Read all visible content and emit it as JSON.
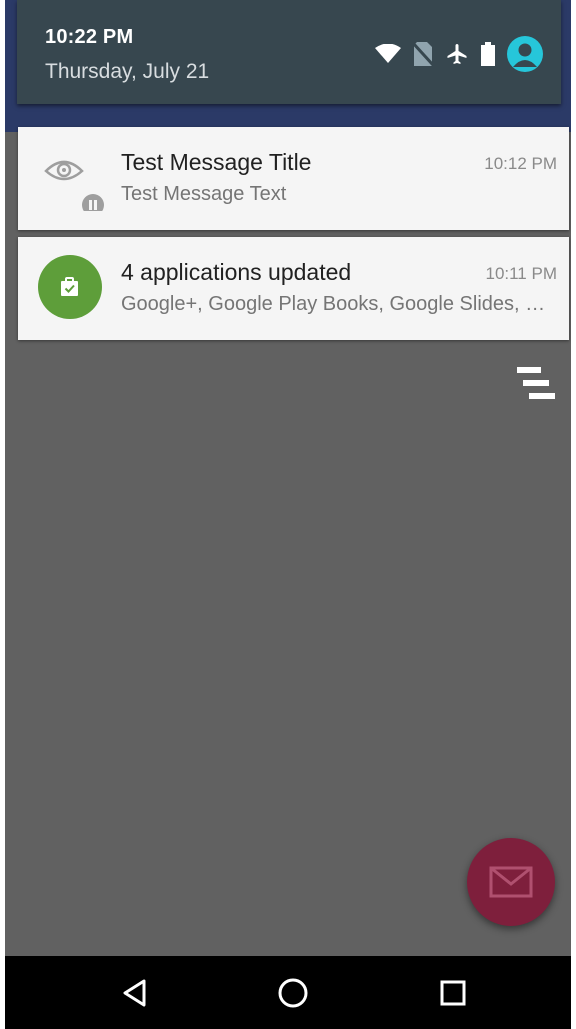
{
  "status_bar": {
    "time": "10:22 PM",
    "date": "Thursday, July 21",
    "icons": [
      "wifi-icon",
      "no-sim-icon",
      "airplane-mode-icon",
      "battery-icon",
      "user-avatar-icon"
    ],
    "avatar_color": "#26c6da"
  },
  "notifications": [
    {
      "icon": "eye-app-icon",
      "title": "Test Message Title",
      "text": "Test Message Text",
      "time": "10:12 PM"
    },
    {
      "icon": "app-update-icon",
      "icon_bg": "#5e9e3a",
      "title": "4 applications updated",
      "text": "Google+, Google Play Books, Google Slides, Google Docs",
      "time": "10:11 PM"
    }
  ],
  "actions": {
    "clear_all_icon": "clear-all-icon",
    "fab_icon": "mail-icon",
    "fab_color": "#7e1f3c"
  },
  "navigation_bar": {
    "buttons": [
      "back-icon",
      "home-icon",
      "recents-icon"
    ]
  }
}
